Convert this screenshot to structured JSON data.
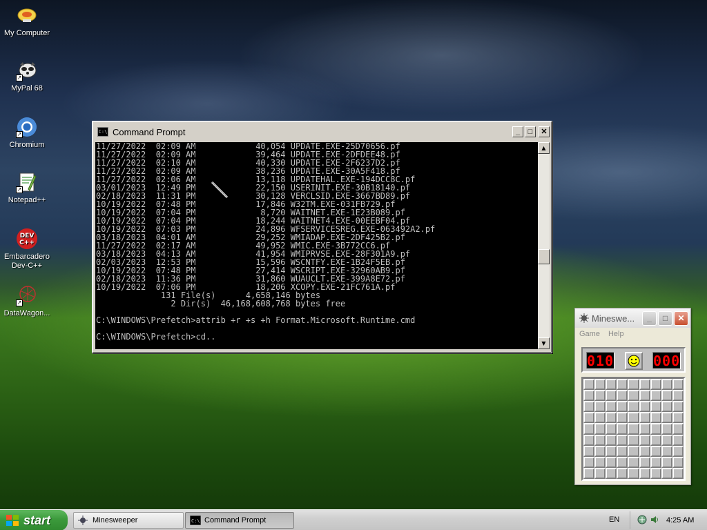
{
  "desktop": {
    "icons": [
      {
        "label": "My Computer"
      },
      {
        "label": "MyPal 68"
      },
      {
        "label": "Chromium"
      },
      {
        "label": "Notepad++"
      },
      {
        "label": "Embarcadero Dev-C++"
      },
      {
        "label": "DataWagon..."
      }
    ],
    "devcpp_icon_text": "DEV C++"
  },
  "cmd": {
    "title": "Command Prompt",
    "icon_text": "C:\\",
    "lines": [
      "11/27/2022  02:09 AM            40,054 UPDATE.EXE-25D70656.pf",
      "11/27/2022  02:09 AM            39,464 UPDATE.EXE-2DFDEE48.pf",
      "11/27/2022  02:10 AM            40,330 UPDATE.EXE-2F6237D2.pf",
      "11/27/2022  02:09 AM            38,236 UPDATE.EXE-30A5F418.pf",
      "11/27/2022  02:06 AM            13,118 UPDATEHAL.EXE-194DCC8C.pf",
      "03/01/2023  12:49 PM            22,150 USERINIT.EXE-30B18140.pf",
      "02/18/2023  11:31 PM            30,128 VERCLSID.EXE-3667BD89.pf",
      "10/19/2022  07:48 PM            17,846 W32TM.EXE-031FB729.pf",
      "10/19/2022  07:04 PM             8,720 WAITNET.EXE-1E23B089.pf",
      "10/19/2022  07:04 PM            18,244 WAITNET4.EXE-00EEBF04.pf",
      "10/19/2022  07:03 PM            24,896 WFSERVICESREG.EXE-063492A2.pf",
      "03/18/2023  04:01 AM            29,252 WMIADAP.EXE-2DF425B2.pf",
      "11/27/2022  02:17 AM            49,952 WMIC.EXE-3B772CC6.pf",
      "03/18/2023  04:13 AM            41,954 WMIPRVSE.EXE-28F301A9.pf",
      "02/03/2023  12:53 PM            15,596 WSCNTFY.EXE-1B24F5EB.pf",
      "10/19/2022  07:48 PM            27,414 WSCRIPT.EXE-32960AB9.pf",
      "02/18/2023  11:36 PM            31,860 WUAUCLT.EXE-399A8E72.pf",
      "10/19/2022  07:06 PM            18,206 XCOPY.EXE-21FC761A.pf",
      "             131 File(s)      4,658,146 bytes",
      "               2 Dir(s)  46,168,608,768 bytes free",
      "",
      "C:\\WINDOWS\\Prefetch>attrib +r +s +h Format.Microsoft.Runtime.cmd",
      "",
      "C:\\WINDOWS\\Prefetch>cd.."
    ],
    "scroll": {
      "up": "▲",
      "down": "▼"
    },
    "buttons": {
      "minimize": "_",
      "maximize": "□",
      "close": "✕"
    }
  },
  "minesweeper": {
    "title": "Mineswe...",
    "menu": [
      "Game",
      "Help"
    ],
    "mine_counter": "010",
    "timer": "000",
    "rows": 9,
    "cols": 9,
    "buttons": {
      "minimize": "_",
      "maximize": "□",
      "close": "✕"
    }
  },
  "taskbar": {
    "start_label": "start",
    "tasks": [
      {
        "label": "Minesweeper",
        "active": false
      },
      {
        "label": "Command Prompt",
        "active": true
      }
    ],
    "language": "EN",
    "clock": "4:25 AM"
  }
}
